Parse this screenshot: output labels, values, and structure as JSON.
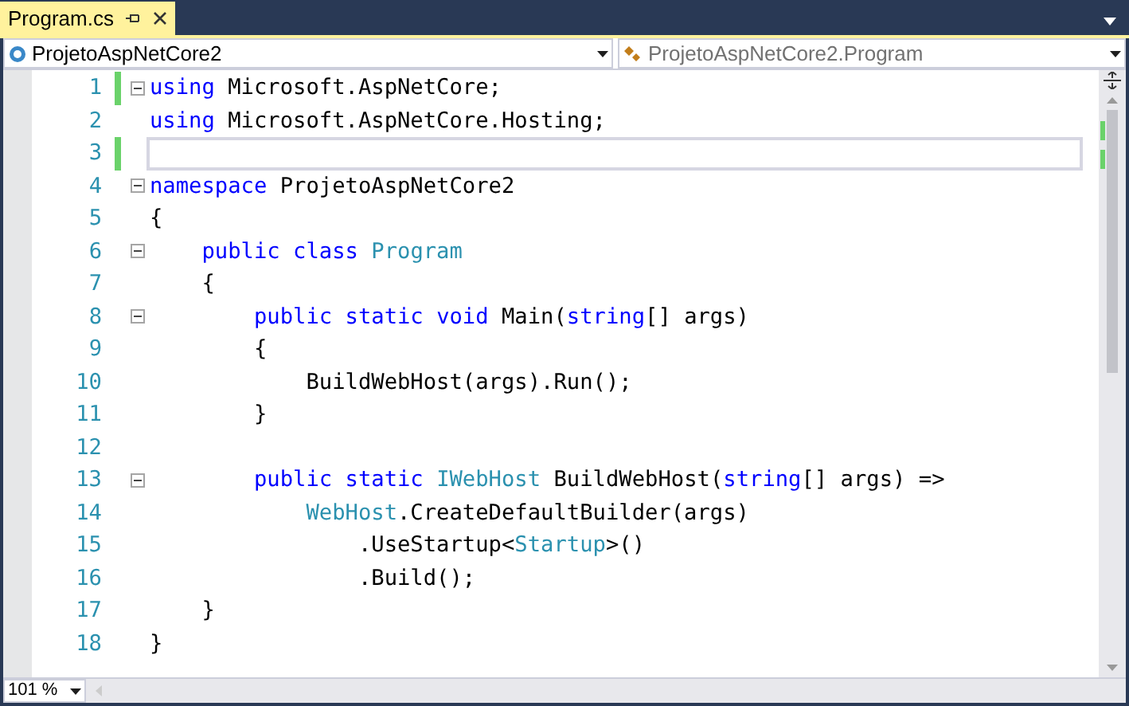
{
  "tab": {
    "title": "Program.cs",
    "selected": true
  },
  "nav": {
    "project": "ProjetoAspNetCore2",
    "member": "ProjetoAspNetCore2.Program"
  },
  "lines": [
    {
      "number": "1",
      "changed": true,
      "current": false,
      "fold": true,
      "tokens": [
        {
          "kind": "kw",
          "text": "using "
        },
        {
          "kind": "plain",
          "text": "Microsoft.AspNetCore;"
        }
      ]
    },
    {
      "number": "2",
      "changed": false,
      "current": false,
      "fold": false,
      "tokens": [
        {
          "kind": "kw",
          "text": "using "
        },
        {
          "kind": "plain",
          "text": "Microsoft.AspNetCore.Hosting;"
        }
      ]
    },
    {
      "number": "3",
      "changed": true,
      "current": true,
      "fold": false
    },
    {
      "number": "4",
      "changed": false,
      "current": false,
      "fold": true,
      "tokens": [
        {
          "kind": "kw",
          "text": "namespace "
        },
        {
          "kind": "plain",
          "text": "ProjetoAspNetCore2"
        }
      ]
    },
    {
      "number": "5",
      "changed": false,
      "current": false,
      "fold": false,
      "tokens": [
        {
          "kind": "plain",
          "text": "{"
        }
      ]
    },
    {
      "number": "6",
      "changed": false,
      "current": false,
      "fold": true,
      "tokens": [
        {
          "kind": "kw",
          "text": "    public "
        },
        {
          "kind": "kw",
          "text": "class "
        },
        {
          "kind": "type",
          "text": "Program"
        }
      ]
    },
    {
      "number": "7",
      "changed": false,
      "current": false,
      "fold": false,
      "tokens": [
        {
          "kind": "plain",
          "text": "    {"
        }
      ]
    },
    {
      "number": "8",
      "changed": false,
      "current": false,
      "fold": true,
      "tokens": [
        {
          "kind": "kw",
          "text": "        public "
        },
        {
          "kind": "kw",
          "text": "static "
        },
        {
          "kind": "kw",
          "text": "void "
        },
        {
          "kind": "plain",
          "text": "Main("
        },
        {
          "kind": "kw",
          "text": "string"
        },
        {
          "kind": "plain",
          "text": "[] args)"
        }
      ]
    },
    {
      "number": "9",
      "changed": false,
      "current": false,
      "fold": false,
      "tokens": [
        {
          "kind": "plain",
          "text": "        {"
        }
      ]
    },
    {
      "number": "10",
      "changed": false,
      "current": false,
      "fold": false,
      "tokens": [
        {
          "kind": "plain",
          "text": "            BuildWebHost(args).Run();"
        }
      ]
    },
    {
      "number": "11",
      "changed": false,
      "current": false,
      "fold": false,
      "tokens": [
        {
          "kind": "plain",
          "text": "        }"
        }
      ]
    },
    {
      "number": "12",
      "changed": false,
      "current": false,
      "fold": false
    },
    {
      "number": "13",
      "changed": false,
      "current": false,
      "fold": true,
      "tokens": [
        {
          "kind": "kw",
          "text": "        public "
        },
        {
          "kind": "kw",
          "text": "static "
        },
        {
          "kind": "type",
          "text": "IWebHost "
        },
        {
          "kind": "plain",
          "text": "BuildWebHost("
        },
        {
          "kind": "kw",
          "text": "string"
        },
        {
          "kind": "plain",
          "text": "[] args) =>"
        }
      ]
    },
    {
      "number": "14",
      "changed": false,
      "current": false,
      "fold": false,
      "tokens": [
        {
          "kind": "type",
          "text": "            WebHost"
        },
        {
          "kind": "plain",
          "text": ".CreateDefaultBuilder(args)"
        }
      ]
    },
    {
      "number": "15",
      "changed": false,
      "current": false,
      "fold": false,
      "tokens": [
        {
          "kind": "plain",
          "text": "                .UseStartup<"
        },
        {
          "kind": "type",
          "text": "Startup"
        },
        {
          "kind": "plain",
          "text": ">()"
        }
      ]
    },
    {
      "number": "16",
      "changed": false,
      "current": false,
      "fold": false,
      "tokens": [
        {
          "kind": "plain",
          "text": "                .Build();"
        }
      ]
    },
    {
      "number": "17",
      "changed": false,
      "current": false,
      "fold": false,
      "tokens": [
        {
          "kind": "plain",
          "text": "    }"
        }
      ]
    },
    {
      "number": "18",
      "changed": false,
      "current": false,
      "fold": false,
      "tokens": [
        {
          "kind": "plain",
          "text": "}"
        }
      ]
    }
  ],
  "zoom": "101 %"
}
